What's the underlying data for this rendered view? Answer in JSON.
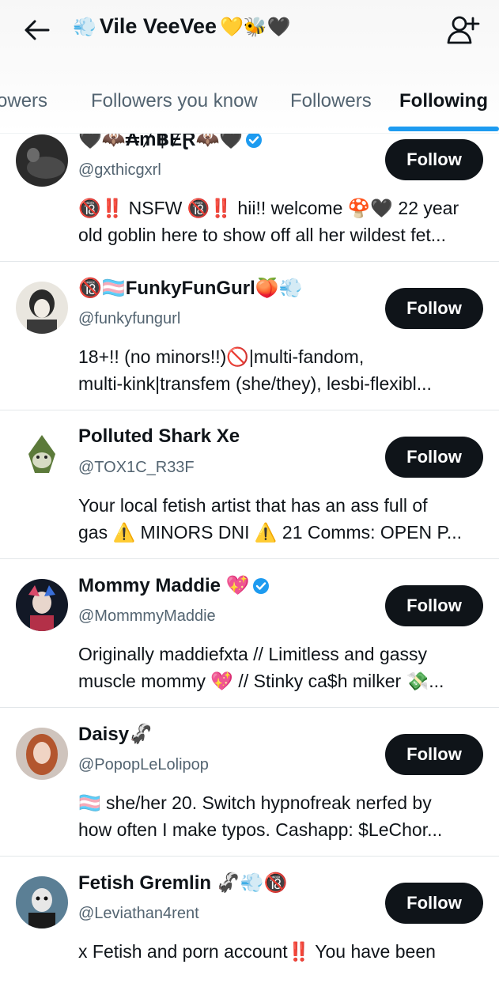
{
  "header": {
    "title": "Vile VeeVee",
    "title_emoji_before": "💨",
    "title_emoji_after": "💛🐝🖤"
  },
  "tabs": [
    {
      "label": "ollowers",
      "active": false
    },
    {
      "label": "Followers you know",
      "active": false
    },
    {
      "label": "Followers",
      "active": false
    },
    {
      "label": "Following",
      "active": true
    }
  ],
  "accent_color": "#1d9bf0",
  "users": [
    {
      "name": "🖤🦇₳₥฿ɆⱤ🦇🖤",
      "verified": true,
      "handle": "@gxthicgxrl",
      "bio_line1": "🔞‼️ NSFW 🔞‼️ hii!! welcome 🍄🖤  22 year",
      "bio_line2": "old goblin here to show off all her wildest fet...",
      "follow_label": "Follow"
    },
    {
      "name": "🔞🏳️‍⚧️FunkyFunGurl🍑💨",
      "verified": false,
      "handle": "@funkyfungurl",
      "bio_line1": "18+!! (no minors!!)🚫|multi-fandom,",
      "bio_line2": "multi-kink|transfem (she/they), lesbi-flexibl...",
      "follow_label": "Follow"
    },
    {
      "name": "Polluted Shark Xe",
      "verified": false,
      "handle": "@TOX1C_R33F",
      "bio_line1": "Your local fetish artist that has an ass full of",
      "bio_line2": "gas ⚠️ MINORS DNI ⚠️  21  Comms: OPEN  P...",
      "follow_label": "Follow"
    },
    {
      "name": "Mommy Maddie 💖",
      "verified": true,
      "handle": "@MommmyMaddie",
      "bio_line1": "Originally maddiefxta // Limitless and gassy",
      "bio_line2": "muscle mommy 💖 // Stinky ca$h milker 💸...",
      "follow_label": "Follow"
    },
    {
      "name": "Daisy🦨",
      "verified": false,
      "handle": "@PopopLeLolipop",
      "bio_line1": "🏳️‍⚧️ she/her 20. Switch hypnofreak nerfed by",
      "bio_line2": "how often I make typos. Cashapp: $LeChor...",
      "follow_label": "Follow"
    },
    {
      "name": "Fetish Gremlin 🦨💨🔞",
      "verified": false,
      "handle": "@Leviathan4rent",
      "bio_line1": "x Fetish and porn account‼️  You have been",
      "bio_line2": "",
      "follow_label": "Follow"
    }
  ]
}
